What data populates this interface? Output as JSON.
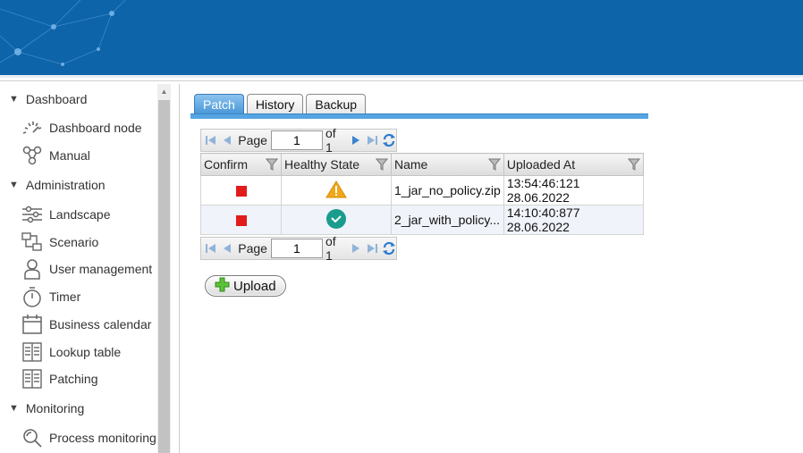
{
  "sidebar": {
    "groups": [
      {
        "label": "Dashboard",
        "items": [
          {
            "label": "Dashboard node",
            "icon": "gauge-icon"
          },
          {
            "label": "Manual",
            "icon": "graph-icon"
          }
        ]
      },
      {
        "label": "Administration",
        "items": [
          {
            "label": "Landscape",
            "icon": "sliders-icon"
          },
          {
            "label": "Scenario",
            "icon": "flow-icon"
          },
          {
            "label": "User management",
            "icon": "user-icon"
          },
          {
            "label": "Timer",
            "icon": "stopwatch-icon"
          },
          {
            "label": "Business calendar",
            "icon": "calendar-icon"
          },
          {
            "label": "Lookup table",
            "icon": "table-icon"
          },
          {
            "label": "Patching",
            "icon": "table-icon"
          }
        ]
      },
      {
        "label": "Monitoring",
        "items": [
          {
            "label": "Process monitoring",
            "icon": "magnifier-icon"
          }
        ]
      }
    ]
  },
  "tabs": [
    {
      "label": "Patch",
      "active": true
    },
    {
      "label": "History",
      "active": false
    },
    {
      "label": "Backup",
      "active": false
    }
  ],
  "pager": {
    "page_label": "Page",
    "page_value": "1",
    "of_label": "of 1"
  },
  "table": {
    "columns": [
      "Confirm",
      "Healthy State",
      "Name",
      "Uploaded At"
    ],
    "rows": [
      {
        "confirm": "red-square",
        "state": "warning-icon",
        "name": "1_jar_no_policy.zip",
        "uploaded": "13:54:46:121 28.06.2022"
      },
      {
        "confirm": "red-square",
        "state": "check-circle-icon",
        "name": "2_jar_with_policy...",
        "uploaded": "14:10:40:877 28.06.2022"
      }
    ]
  },
  "upload_label": "Upload",
  "colors": {
    "banner": "#0d64a9",
    "tab_active": "#4a98d8",
    "confirm": "#e21b1b",
    "warning": "#f0a818",
    "ok": "#1a9c8c"
  }
}
